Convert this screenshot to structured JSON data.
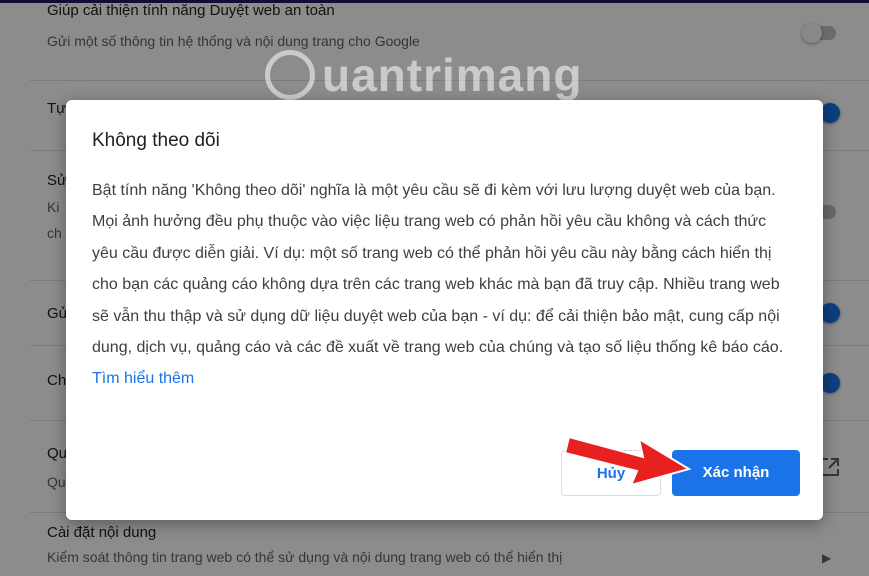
{
  "background": {
    "rows": [
      {
        "title": "Giúp cải thiện tính năng Duyệt web an toàn",
        "sub": "Gửi một số thông tin hệ thống và nội dung trang cho Google"
      },
      {
        "title": "Tự"
      },
      {
        "title": "Sử",
        "sub": "Ki",
        "sub2": "ch"
      },
      {
        "title": "Gử"
      },
      {
        "title": "Ch"
      },
      {
        "title": "Qu",
        "sub": "Qu"
      },
      {
        "title": "Cài đặt nội dung",
        "sub": "Kiểm soát thông tin trang web có thể sử dụng và nội dung trang web có thể hiển thị"
      }
    ]
  },
  "watermark": "uantrimang",
  "dialog": {
    "title": "Không theo dõi",
    "body": "Bật tính năng 'Không theo dõi' nghĩa là một yêu cầu sẽ đi kèm với lưu lượng duyệt web của bạn. Mọi ảnh hưởng đều phụ thuộc vào việc liệu trang web có phản hồi yêu cầu không và cách thức yêu cầu được diễn giải. Ví dụ: một số trang web có thể phản hồi yêu cầu này bằng cách hiển thị cho bạn các quảng cáo không dựa trên các trang web khác mà bạn đã truy cập. Nhiều trang web sẽ vẫn thu thập và sử dụng dữ liệu duyệt web của bạn - ví dụ: để cải thiện bảo mật, cung cấp nội dung, dịch vụ, quảng cáo và các đề xuất về trang web của chúng và tạo số liệu thống kê báo cáo.",
    "link": "Tìm hiểu thêm",
    "cancel_label": "Hủy",
    "confirm_label": "Xác nhận"
  },
  "colors": {
    "accent": "#1a73e8",
    "annotation_arrow": "#e8201f"
  }
}
